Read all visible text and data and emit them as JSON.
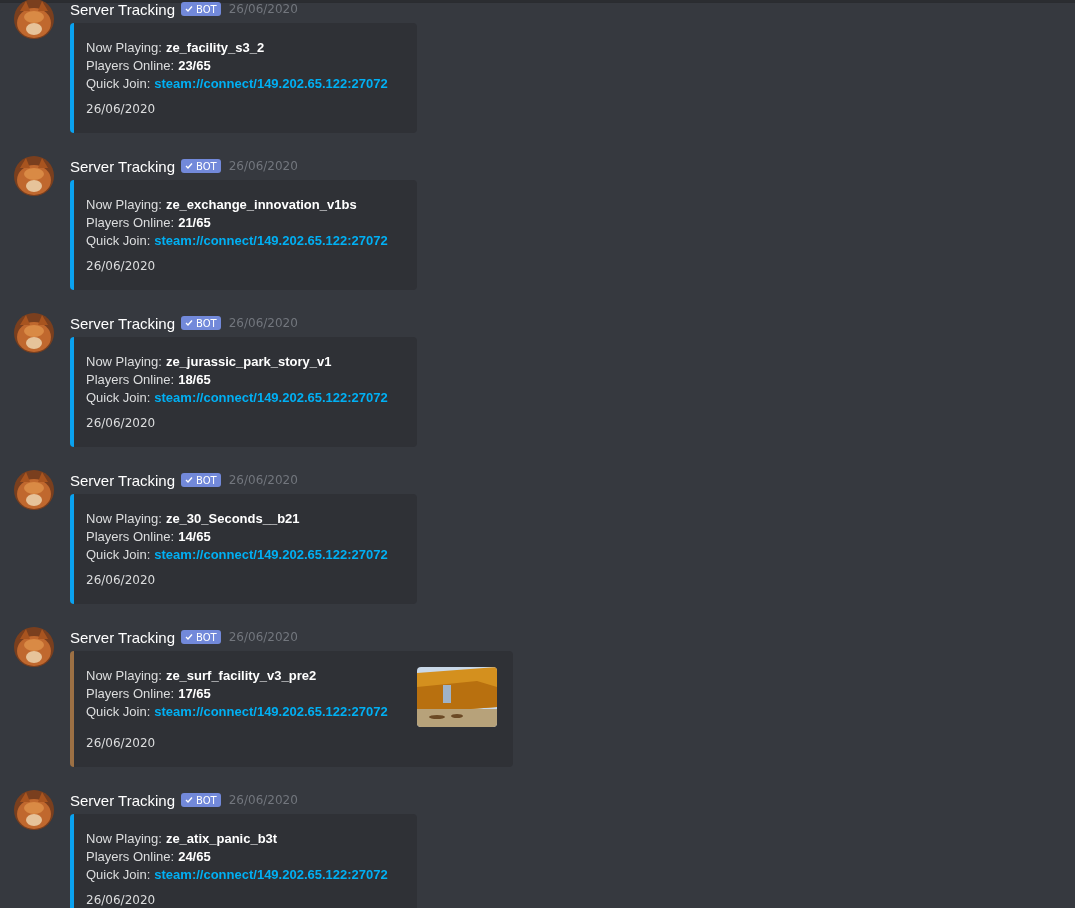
{
  "messages": [
    {
      "author": "Server Tracking",
      "badge": "BOT",
      "timestamp": "26/06/2020",
      "embed": {
        "color": "#0aa2f0",
        "fields": [
          {
            "label": "Now Playing:",
            "value": "ze_facility_s3_2",
            "kind": "text"
          },
          {
            "label": "Players Online:",
            "value": "23/65",
            "kind": "text"
          },
          {
            "label": "Quick Join:",
            "value": "steam://connect/149.202.65.122:27072",
            "kind": "link"
          }
        ],
        "footer": "26/06/2020"
      }
    },
    {
      "author": "Server Tracking",
      "badge": "BOT",
      "timestamp": "26/06/2020",
      "embed": {
        "color": "#0aa2f0",
        "fields": [
          {
            "label": "Now Playing:",
            "value": "ze_exchange_innovation_v1bs",
            "kind": "text"
          },
          {
            "label": "Players Online:",
            "value": "21/65",
            "kind": "text"
          },
          {
            "label": "Quick Join:",
            "value": "steam://connect/149.202.65.122:27072",
            "kind": "link"
          }
        ],
        "footer": "26/06/2020"
      }
    },
    {
      "author": "Server Tracking",
      "badge": "BOT",
      "timestamp": "26/06/2020",
      "embed": {
        "color": "#0aa2f0",
        "fields": [
          {
            "label": "Now Playing:",
            "value": "ze_jurassic_park_story_v1",
            "kind": "text"
          },
          {
            "label": "Players Online:",
            "value": "18/65",
            "kind": "text"
          },
          {
            "label": "Quick Join:",
            "value": "steam://connect/149.202.65.122:27072",
            "kind": "link"
          }
        ],
        "footer": "26/06/2020"
      }
    },
    {
      "author": "Server Tracking",
      "badge": "BOT",
      "timestamp": "26/06/2020",
      "embed": {
        "color": "#0aa2f0",
        "fields": [
          {
            "label": "Now Playing:",
            "value": "ze_30_Seconds__b21",
            "kind": "text"
          },
          {
            "label": "Players Online:",
            "value": "14/65",
            "kind": "text"
          },
          {
            "label": "Quick Join:",
            "value": "steam://connect/149.202.65.122:27072",
            "kind": "link"
          }
        ],
        "footer": "26/06/2020"
      }
    },
    {
      "author": "Server Tracking",
      "badge": "BOT",
      "timestamp": "26/06/2020",
      "embed": {
        "color": "#9c7044",
        "fields": [
          {
            "label": "Now Playing:",
            "value": "ze_surf_facility_v3_pre2",
            "kind": "text"
          },
          {
            "label": "Players Online:",
            "value": "17/65",
            "kind": "text"
          },
          {
            "label": "Quick Join:",
            "value": "steam://connect/149.202.65.122:27072",
            "kind": "link"
          }
        ],
        "footer": "26/06/2020"
      }
    },
    {
      "author": "Server Tracking",
      "badge": "BOT",
      "timestamp": "26/06/2020",
      "embed": {
        "color": "#0aa2f0",
        "fields": [
          {
            "label": "Now Playing:",
            "value": "ze_atix_panic_b3t",
            "kind": "text"
          },
          {
            "label": "Players Online:",
            "value": "24/65",
            "kind": "text"
          },
          {
            "label": "Quick Join:",
            "value": "steam://connect/149.202.65.122:27072",
            "kind": "link"
          }
        ],
        "footer": "26/06/2020"
      }
    }
  ]
}
